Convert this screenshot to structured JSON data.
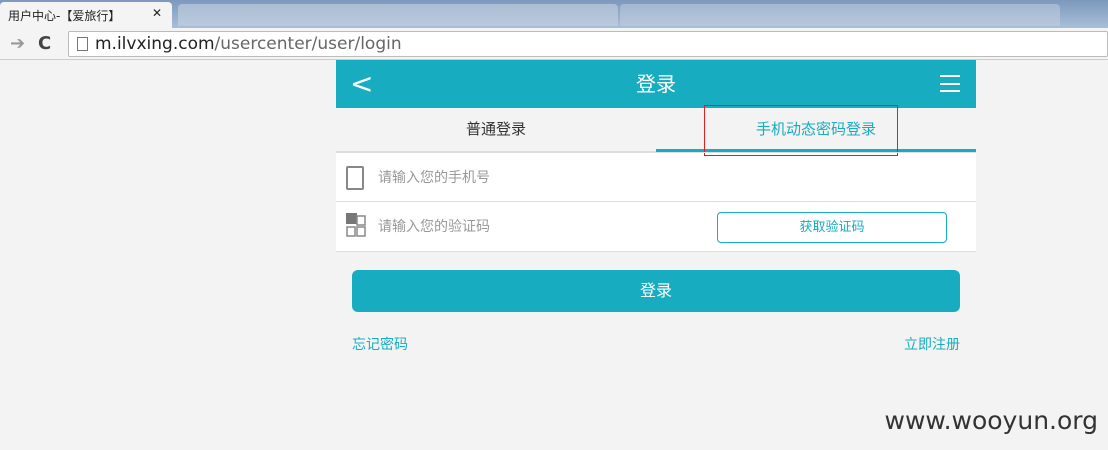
{
  "browser": {
    "tab_title": "用户中心-【爱旅行】",
    "url_host": "m.ilvxing.com",
    "url_path": "/usercenter/user/login"
  },
  "header": {
    "title": "登录"
  },
  "tabs": [
    {
      "label": "普通登录",
      "active": false
    },
    {
      "label": "手机动态密码登录",
      "active": true
    }
  ],
  "form": {
    "phone_placeholder": "请输入您的手机号",
    "code_placeholder": "请输入您的验证码",
    "get_code": "获取验证码"
  },
  "login_button": "登录",
  "links": {
    "forgot": "忘记密码",
    "register": "立即注册"
  },
  "watermark": "www.wooyun.org",
  "colors": {
    "accent": "#17acbf",
    "highlight_box": "#e02020"
  }
}
